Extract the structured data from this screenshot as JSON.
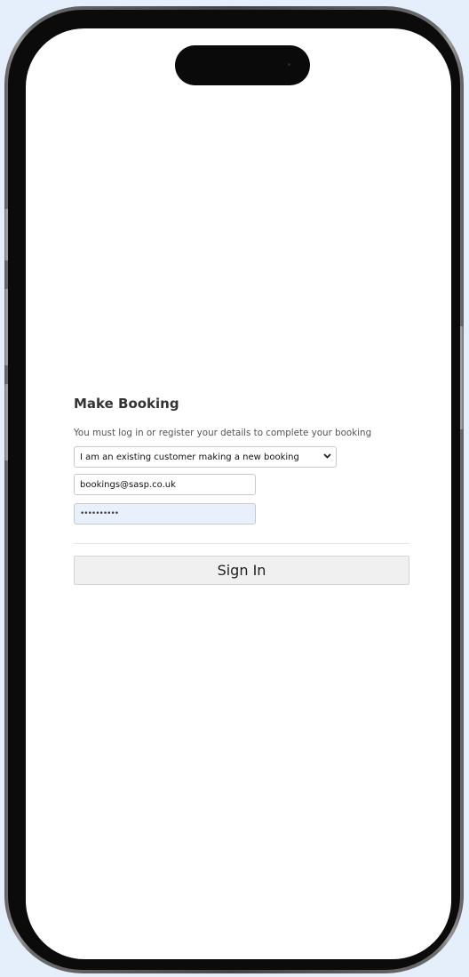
{
  "form": {
    "title": "Make Booking",
    "subtitle": "You must log in or register your details to complete your booking",
    "customer_type": {
      "selected": "I am an existing customer making a new booking"
    },
    "email": {
      "value": "bookings@sasp.co.uk"
    },
    "password": {
      "masked_value": "••••••••••"
    },
    "sign_in_label": "Sign In"
  },
  "colors": {
    "background": "#e4effb",
    "screen": "#ffffff",
    "password_autofill": "#e8f0fc",
    "button_bg": "#f0f0f0"
  },
  "icons": {
    "select_chevron": "chevron-down-icon"
  }
}
